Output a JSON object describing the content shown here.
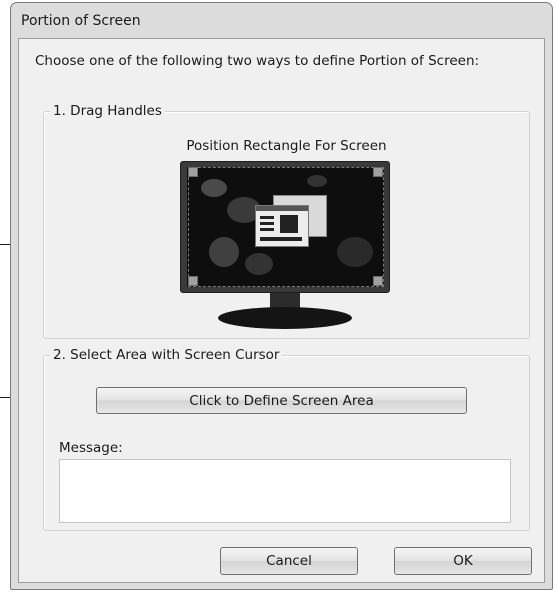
{
  "dialog": {
    "title": "Portion of Screen",
    "instructions": "Choose one of the following two ways to define Portion of Screen:"
  },
  "drag_handles": {
    "legend": "1. Drag Handles",
    "preview_caption": "Position Rectangle For Screen"
  },
  "select_area": {
    "legend": "2. Select Area with Screen Cursor",
    "define_button": "Click to Define Screen Area",
    "message_label": "Message:",
    "message_value": ""
  },
  "buttons": {
    "cancel": "Cancel",
    "ok": "OK"
  },
  "colors": {
    "window_frame": "#dcdcdc",
    "client_bg": "#f0f0f0",
    "monitor": "#3a3a3a",
    "screen": "#0e0e0e"
  }
}
